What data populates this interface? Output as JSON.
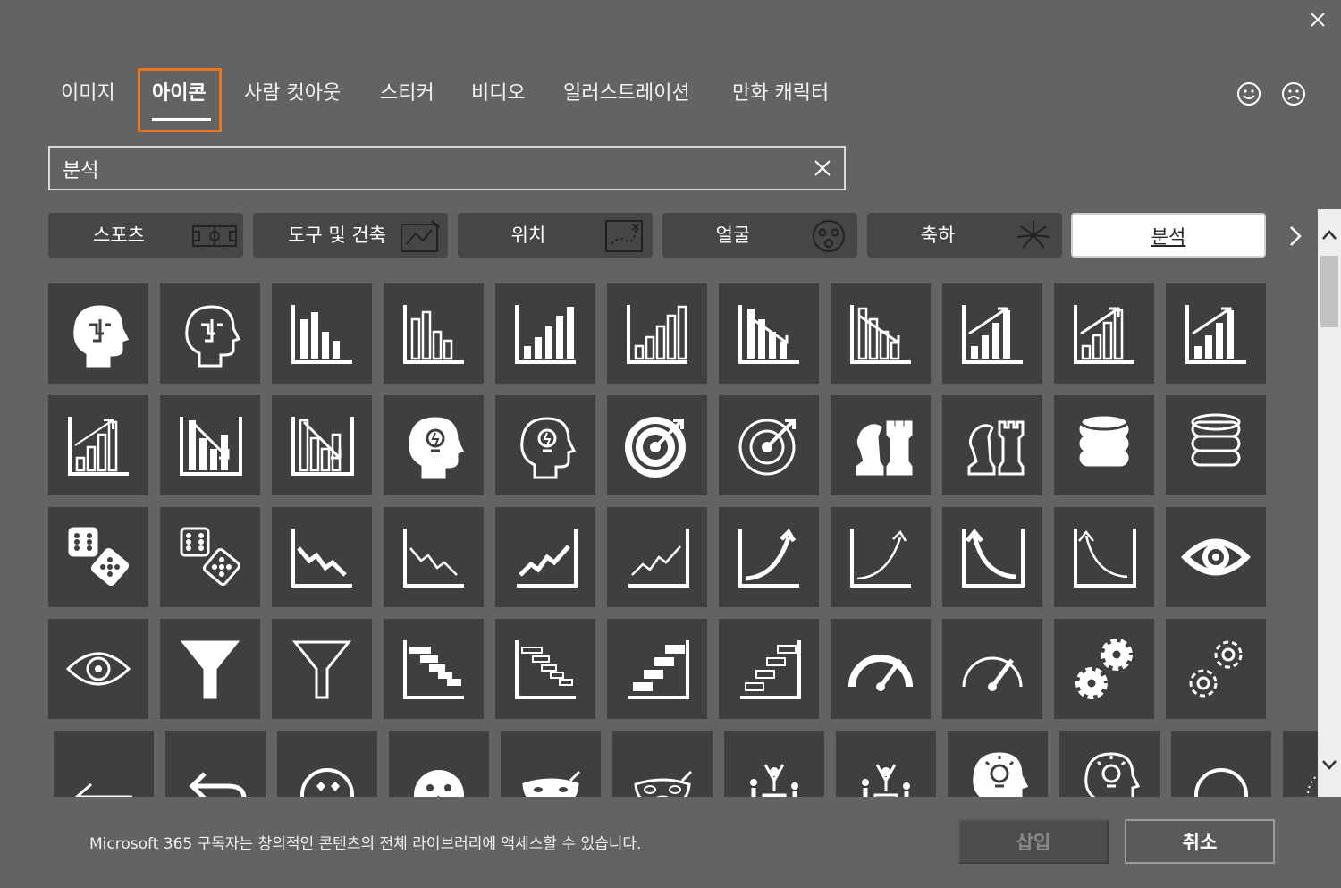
{
  "tabs": [
    {
      "label": "이미지"
    },
    {
      "label": "아이콘"
    },
    {
      "label": "사람 컷아웃"
    },
    {
      "label": "스티커"
    },
    {
      "label": "비디오"
    },
    {
      "label": "일러스트레이션"
    },
    {
      "label": "만화 캐릭터"
    }
  ],
  "active_tab": "아이콘",
  "search": {
    "value": "분석"
  },
  "categories": [
    {
      "label": "스포츠",
      "icon": "soccer-field-icon"
    },
    {
      "label": "도구 및 건축",
      "icon": "blueprint-icon"
    },
    {
      "label": "위치",
      "icon": "treasure-map-icon"
    },
    {
      "label": "얼굴",
      "icon": "surprised-face-icon"
    },
    {
      "label": "축하",
      "icon": "fireworks-icon"
    },
    {
      "label": "분석",
      "icon": "",
      "selected": true
    }
  ],
  "icon_grid": [
    [
      "head-brain-filled-icon",
      "head-brain-outline-icon",
      "bar-chart-filled-icon",
      "bar-chart-outline-icon",
      "bar-chart-rising-filled-icon",
      "bar-chart-rising-outline-icon",
      "bar-chart-decline-filled-icon",
      "bar-chart-decline-outline-icon",
      "bar-chart-growth-arrow-filled-icon",
      "bar-chart-growth-arrow-outline-icon",
      "bar-chart-growth-arrow-boxed-icon"
    ],
    [
      "bar-chart-growth-arrow-thin-icon",
      "bar-chart-down-arrow-filled-icon",
      "bar-chart-down-arrow-outline-icon",
      "head-lightbulb-filled-icon",
      "head-lightbulb-outline-icon",
      "target-arrow-filled-icon",
      "target-arrow-outline-icon",
      "chess-pieces-filled-icon",
      "chess-pieces-outline-icon",
      "database-filled-icon",
      "database-outline-icon"
    ],
    [
      "dice-filled-icon",
      "dice-outline-icon",
      "line-chart-down-filled-icon",
      "line-chart-down-outline-icon",
      "line-chart-up-filled-icon",
      "line-chart-up-outline-icon",
      "exponential-curve-filled-icon",
      "exponential-curve-outline-icon",
      "decay-curve-filled-icon",
      "decay-curve-outline-icon",
      "eye-filled-icon"
    ],
    [
      "eye-outline-icon",
      "funnel-filled-icon",
      "funnel-outline-icon",
      "gantt-chart-filled-icon",
      "gantt-chart-outline-icon",
      "stairs-chart-filled-icon",
      "stairs-chart-outline-icon",
      "speedometer-filled-icon",
      "speedometer-outline-icon",
      "gears-filled-icon",
      "gears-outline-icon"
    ],
    [
      "arrow-left-icon",
      "undo-arrow-icon",
      "heart-eyes-face-icon",
      "kiss-face-icon",
      "mask-filled-icon",
      "mask-outline-icon",
      "podium-people-filled-icon",
      "podium-people-outline-icon",
      "head-idea-filled-icon",
      "head-idea-outline-icon",
      "circle-outline-icon",
      "dotted-circle-icon"
    ]
  ],
  "footer": {
    "notice": "Microsoft 365 구독자는 창의적인 콘텐츠의 전체 라이브러리에 액세스할 수 있습니다.",
    "insert_label": "삽입",
    "cancel_label": "취소"
  }
}
